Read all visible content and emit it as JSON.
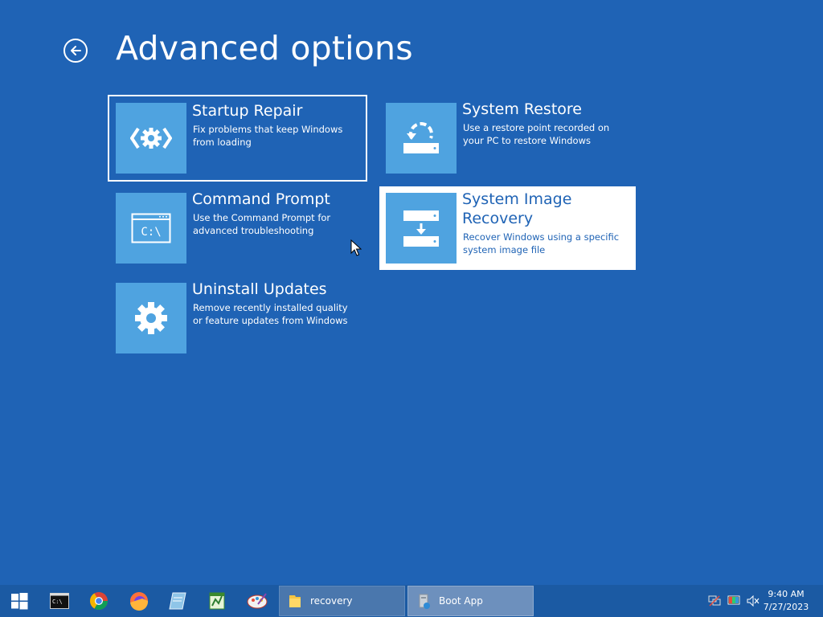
{
  "page": {
    "title": "Advanced options"
  },
  "options": [
    {
      "title": "Startup Repair",
      "description": "Fix problems that keep Windows from loading",
      "icon": "startup-repair-icon"
    },
    {
      "title": "System Restore",
      "description": "Use a restore point recorded on your PC to restore Windows",
      "icon": "system-restore-icon"
    },
    {
      "title": "Command Prompt",
      "description": "Use the Command Prompt for advanced troubleshooting",
      "icon": "command-prompt-icon",
      "icon_text": "C:\\"
    },
    {
      "title": "System Image Recovery",
      "description": "Recover Windows using a specific system image file",
      "icon": "system-image-recovery-icon"
    },
    {
      "title": "Uninstall Updates",
      "description": "Remove recently installed quality or feature updates from Windows",
      "icon": "gear-icon"
    }
  ],
  "taskbar": {
    "pinned": [
      "windows-start-icon",
      "terminal-icon",
      "chrome-icon",
      "firefox-icon",
      "notepad-icon",
      "spreadsheet-icon",
      "paint-icon"
    ],
    "apps": [
      {
        "label": "recovery",
        "icon": "folder-icon"
      },
      {
        "label": "Boot App",
        "icon": "boot-app-icon"
      }
    ],
    "tray_icons": [
      "network-icon",
      "display-color-icon",
      "volume-muted-icon"
    ],
    "time": "9:40 AM",
    "date": "7/27/2023"
  },
  "colors": {
    "background": "#1f63b5",
    "tile": "#4fa3e0",
    "taskbar": "#1b5aa3"
  }
}
